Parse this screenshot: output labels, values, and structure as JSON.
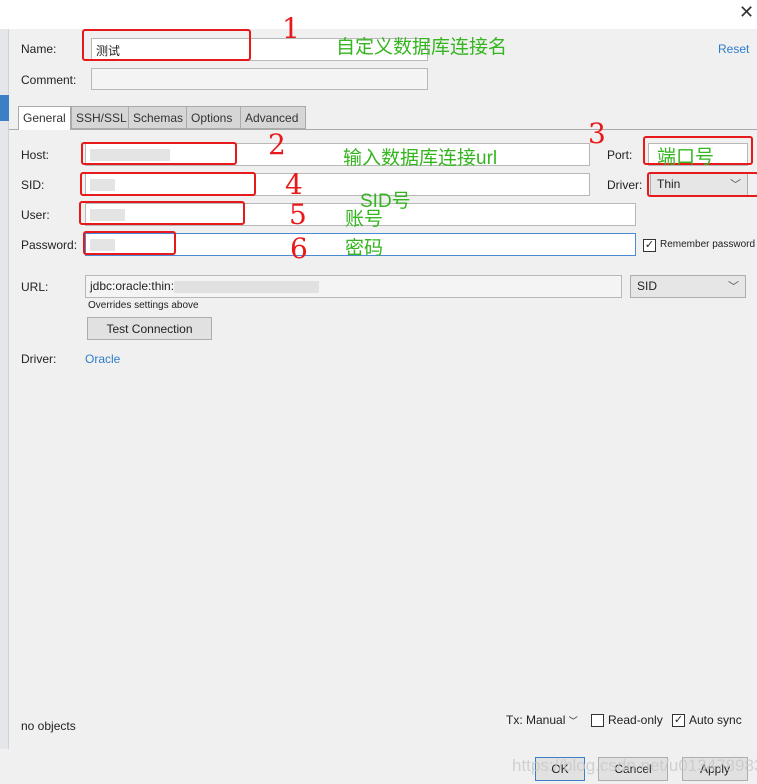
{
  "window": {
    "close_icon": "close-icon"
  },
  "form": {
    "name_label": "Name:",
    "name_value": "测试",
    "reset": "Reset",
    "comment_label": "Comment:",
    "comment_value": ""
  },
  "tabs": [
    {
      "label": "General",
      "active": true
    },
    {
      "label": "SSH/SSL"
    },
    {
      "label": "Schemas"
    },
    {
      "label": "Options"
    },
    {
      "label": "Advanced"
    }
  ],
  "general": {
    "host_label": "Host:",
    "port_label": "Port:",
    "sid_label": "SID:",
    "driver_label": "Driver:",
    "driver_value": "Thin",
    "user_label": "User:",
    "password_label": "Password:",
    "remember_password": "Remember password",
    "remember_checked": true,
    "url_label": "URL:",
    "url_value": "jdbc:oracle:thin:",
    "url_mode": "SID",
    "overrides_note": "Overrides settings above",
    "test_connection": "Test Connection",
    "driver2_label": "Driver:",
    "driver_link": "Oracle"
  },
  "footer": {
    "objects": "no objects",
    "tx": "Tx: Manual",
    "read_only": "Read-only",
    "read_only_checked": false,
    "auto_sync": "Auto sync",
    "auto_sync_checked": true,
    "ok": "OK",
    "cancel": "Cancel",
    "apply": "Apply"
  },
  "annotations": {
    "n1": "1",
    "t1": "自定义数据库连接名",
    "n2": "2",
    "t2": "输入数据库连接url",
    "n3": "3",
    "t3": "端口号",
    "n4": "4",
    "t4": "SID号",
    "n5": "5",
    "t5": "账号",
    "n6": "6",
    "t6": "密码"
  },
  "watermark": "https://blog.csdn.net/u013478983"
}
